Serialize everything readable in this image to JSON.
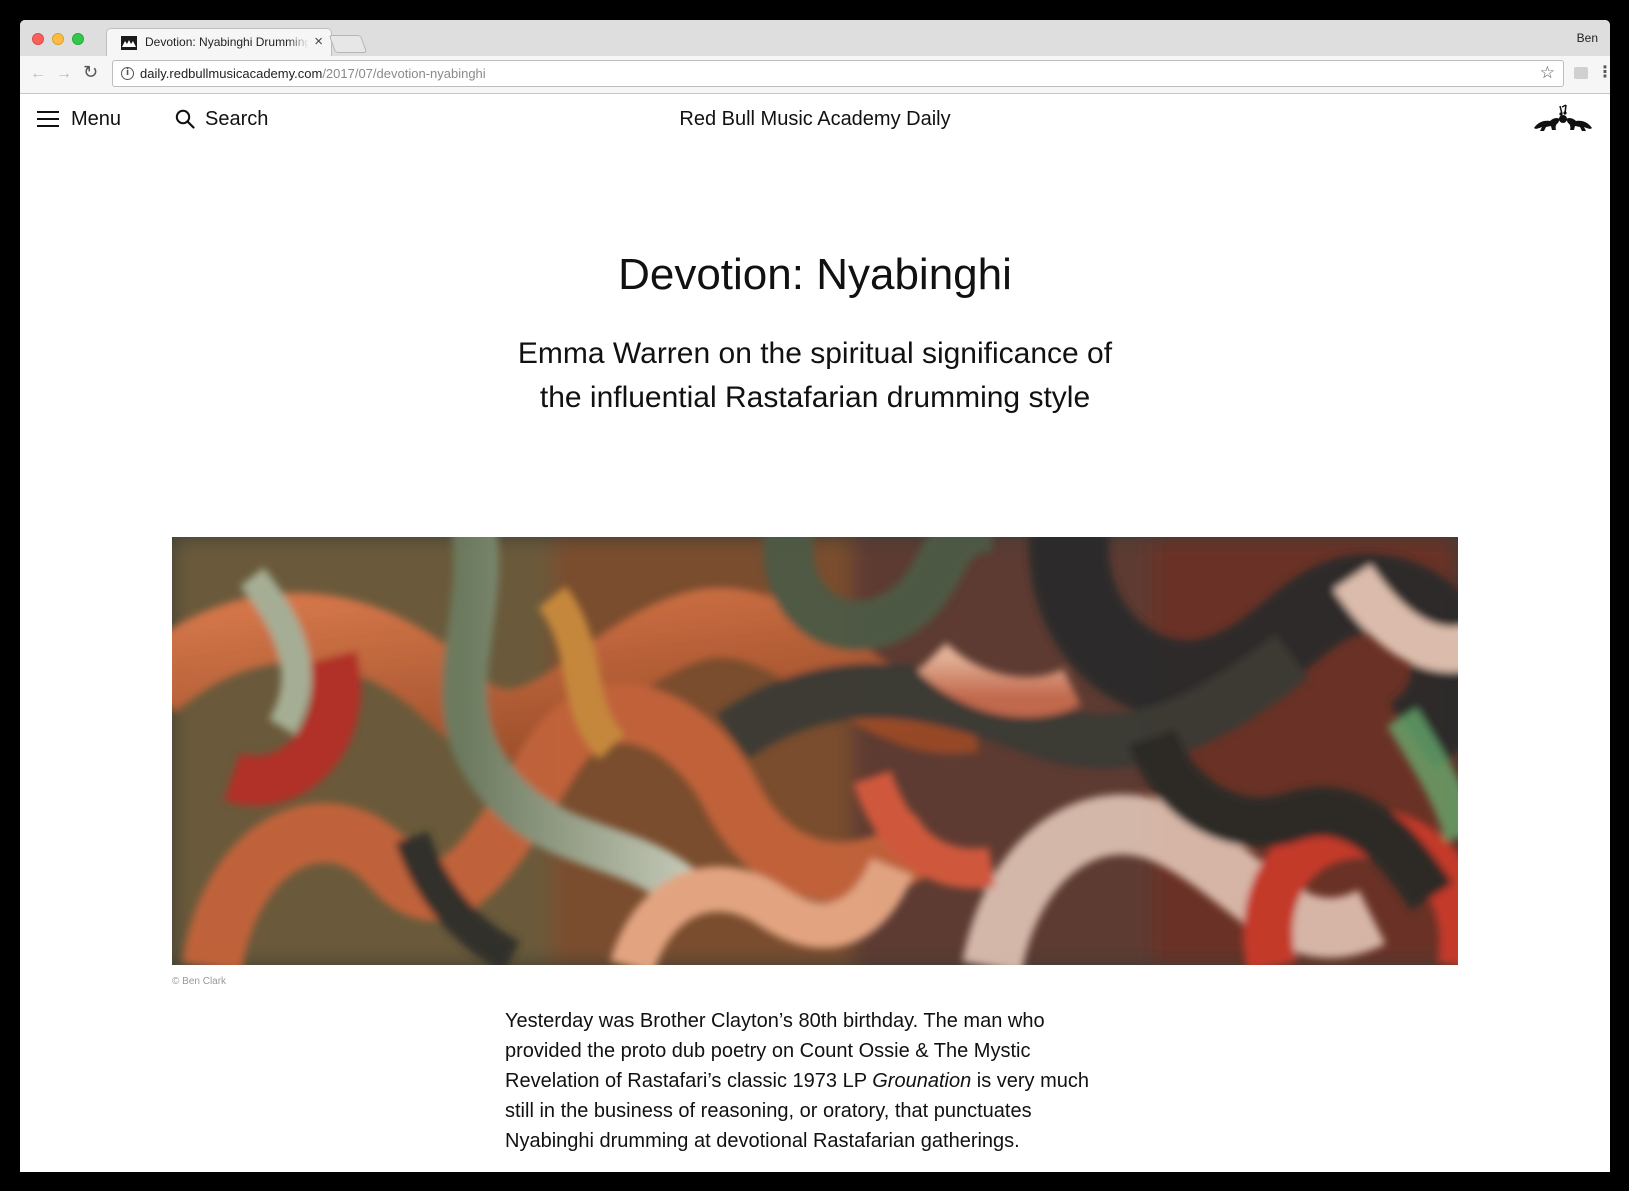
{
  "browser": {
    "tab_title": "Devotion: Nyabinghi Drumming",
    "tab_close": "×",
    "profile_name": "Ben",
    "url_host": "daily.redbullmusicacademy.com",
    "url_path": "/2017/07/devotion-nyabinghi",
    "icons": [
      "back-icon",
      "forward-icon",
      "reload-icon",
      "info-icon",
      "star-icon",
      "extension-icon",
      "menu-kebab-icon"
    ]
  },
  "header": {
    "menu_label": "Menu",
    "search_label": "Search",
    "site_title": "Red Bull Music Academy Daily"
  },
  "article": {
    "title": "Devotion: Nyabinghi",
    "subtitle": "Emma Warren on the spiritual significance of the influential Rastafarian drumming style",
    "image_credit": "© Ben Clark",
    "body_before": "Yesterday was Brother Clayton’s 80th birthday. The man who provided the proto dub poetry on Count Ossie & The Mystic Revelation of Rastafari’s classic 1973 LP ",
    "body_italic": "Grounation",
    "body_after": " is very much still in the business of reasoning, or oratory, that punctuates Nyabinghi drumming at devotional Rastafarian gatherings."
  },
  "colors": {
    "page_bg": "#ffffff",
    "text": "#111111",
    "tabstrip": "#dedede",
    "toolbar": "#f6f6f6",
    "credit": "#999999"
  }
}
